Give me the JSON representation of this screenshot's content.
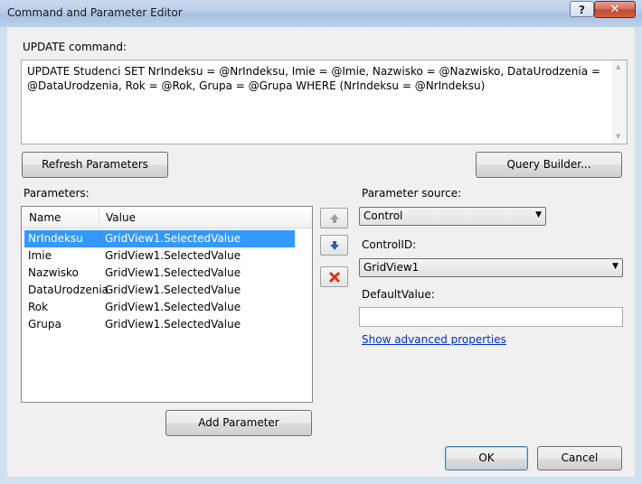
{
  "window": {
    "title": "Command and Parameter Editor",
    "help_label": "?",
    "close_label": "✕"
  },
  "update_command": {
    "label": "UPDATE command:",
    "line1": "UPDATE Studenci SET NrIndeksu = @NrIndeksu, Imie = @Imie, Nazwisko = @Nazwisko, DataUrodzenia =",
    "line2": "@DataUrodzenia, Rok = @Rok, Grupa = @Grupa WHERE (NrIndeksu = @NrIndeksu)"
  },
  "buttons": {
    "refresh": "Refresh Parameters",
    "query_builder": "Query Builder...",
    "add_parameter": "Add Parameter",
    "ok": "OK",
    "cancel": "Cancel"
  },
  "parameters": {
    "label": "Parameters:",
    "columns": [
      "Name",
      "Value"
    ],
    "rows": [
      {
        "name": "NrIndeksu",
        "value": "GridView1.SelectedValue",
        "selected": true
      },
      {
        "name": "Imie",
        "value": "GridView1.SelectedValue"
      },
      {
        "name": "Nazwisko",
        "value": "GridView1.SelectedValue"
      },
      {
        "name": "DataUrodzenia",
        "value": "GridView1.SelectedValue"
      },
      {
        "name": "Rok",
        "value": "GridView1.SelectedValue"
      },
      {
        "name": "Grupa",
        "value": "GridView1.SelectedValue"
      }
    ]
  },
  "side_buttons": {
    "up_icon": "arrow-up-icon",
    "down_icon": "arrow-down-icon",
    "delete_icon": "delete-x-icon"
  },
  "right_panel": {
    "source_label": "Parameter source:",
    "source_value": "Control",
    "control_id_label": "ControlID:",
    "control_id_value": "GridView1",
    "default_label": "DefaultValue:",
    "default_value": "",
    "advanced_link": "Show advanced properties"
  }
}
